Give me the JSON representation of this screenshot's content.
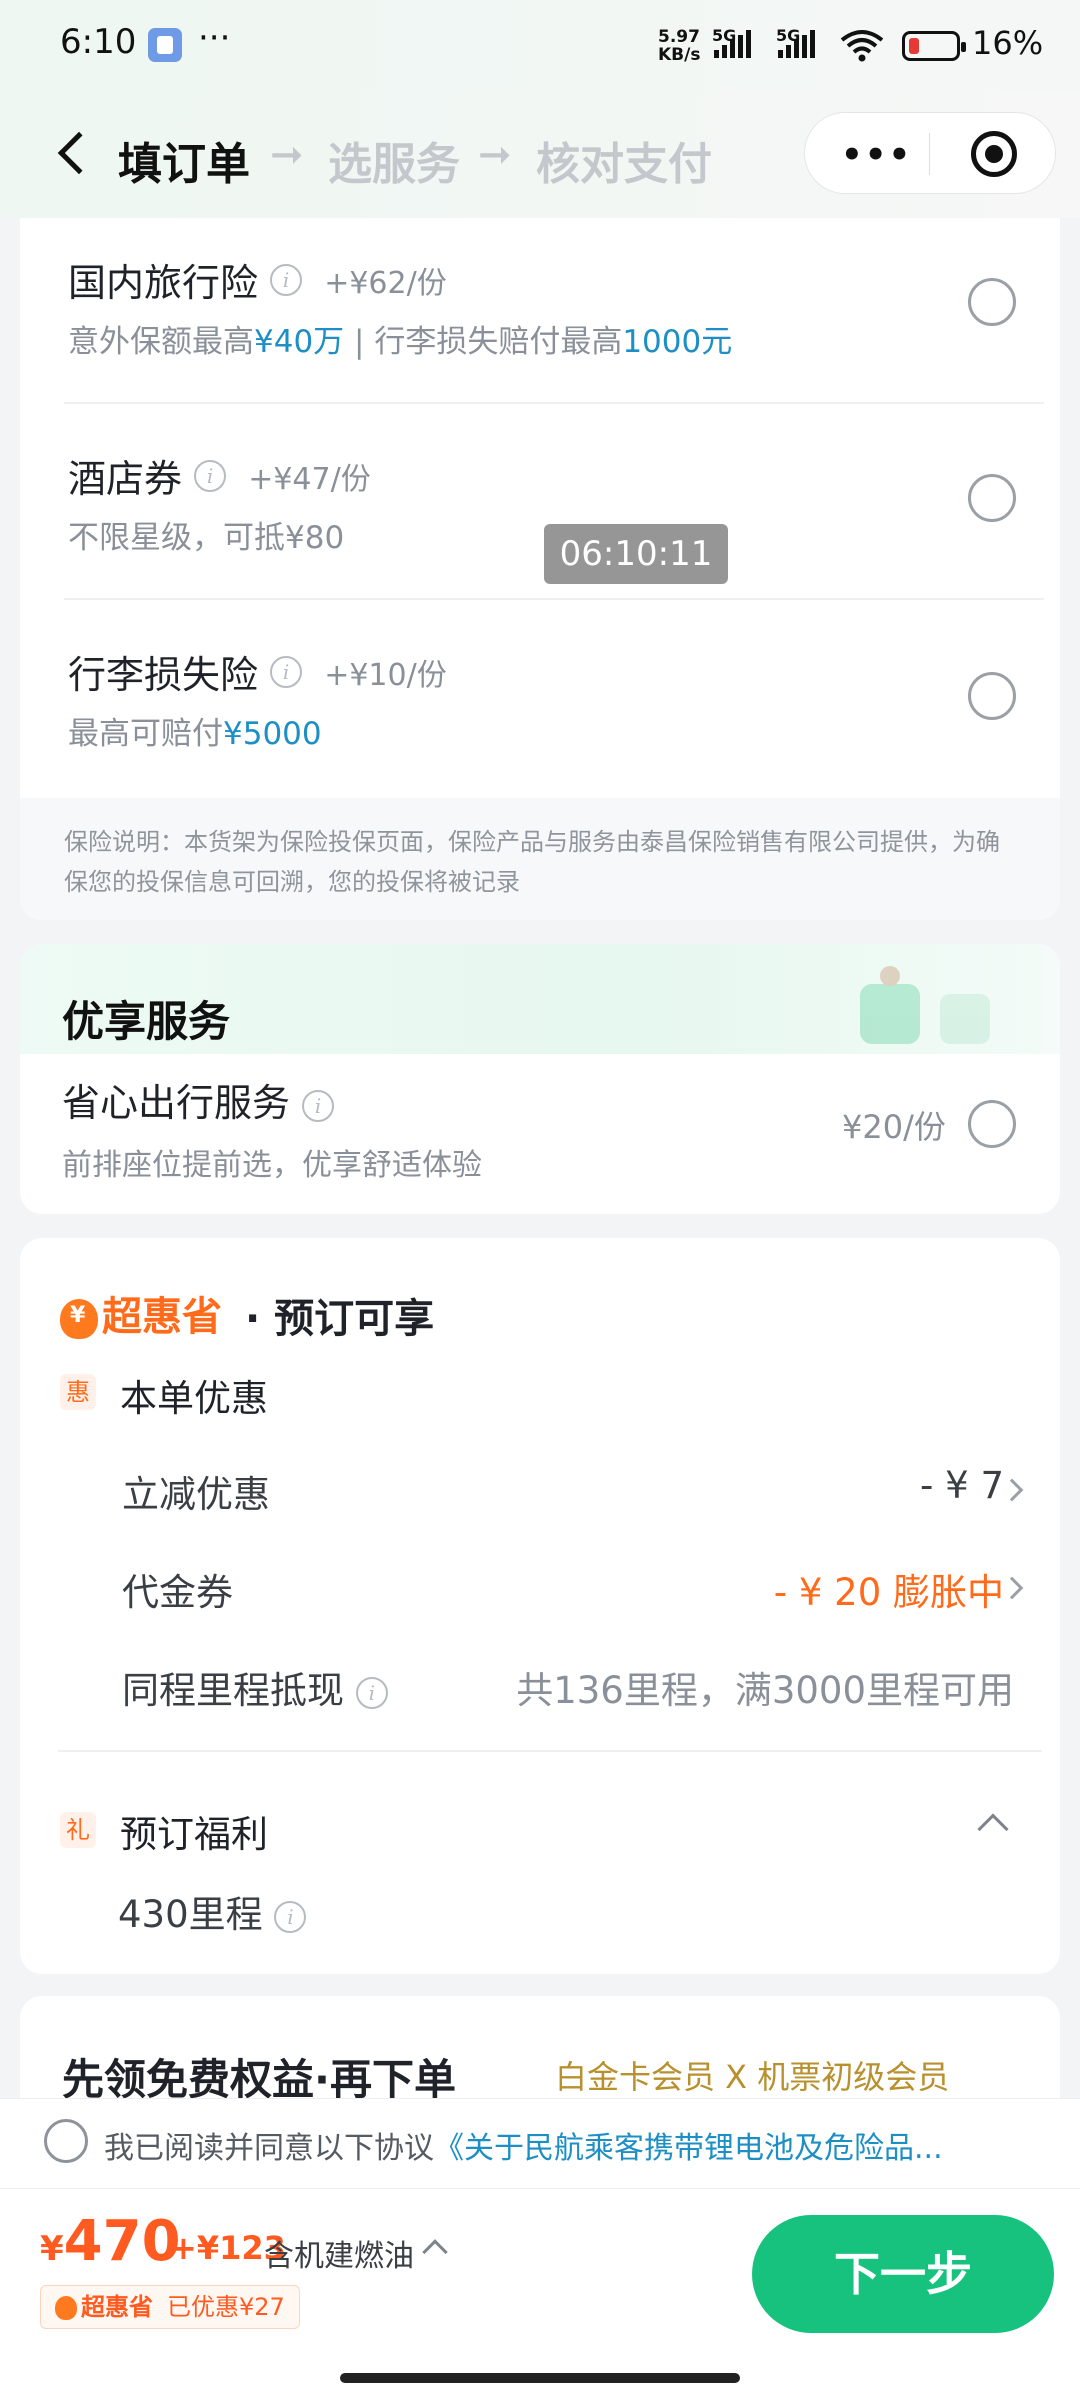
{
  "status_bar": {
    "time": "6:10",
    "more": "···",
    "net_speed_value": "5.97",
    "net_speed_unit": "KB/s",
    "sim1": "5G",
    "sim2": "5G",
    "battery": "16%"
  },
  "nav": {
    "steps": [
      "填订单",
      "选服务",
      "核对支付"
    ],
    "arrow": "➞",
    "capsule_more": "•••"
  },
  "insurance": {
    "items": [
      {
        "title": "国内旅行险",
        "price": "+¥62/份",
        "desc_pre": "意外保额最高",
        "desc_hl": "¥40万",
        "desc_mid": " | 行李损失赔付最高",
        "desc_hl2": "1000元"
      },
      {
        "title": "酒店券",
        "price": "+¥47/份",
        "desc_pre": "不限星级，可抵¥80",
        "desc_hl": "",
        "desc_mid": "",
        "desc_hl2": ""
      },
      {
        "title": "行李损失险",
        "price": "+¥10/份",
        "desc_pre": "最高可赔付",
        "desc_hl": "¥5000",
        "desc_mid": "",
        "desc_hl2": ""
      }
    ],
    "note": "保险说明：本货架为保险投保页面，保险产品与服务由泰昌保险销售有限公司提供，为确保您的投保信息可回溯，您的投保将被记录"
  },
  "service": {
    "heading": "优享服务",
    "name": "省心出行服务",
    "desc": "前排座位提前选，优享舒适体验",
    "price": "¥20/份"
  },
  "discount": {
    "brand": "超惠省",
    "title": "· 预订可享",
    "section1_tag": "惠",
    "section1_label": "本单优惠",
    "rows": [
      {
        "label": "立减优惠",
        "value": "- ¥ 7"
      },
      {
        "label": "代金券",
        "value": "- ¥ 20  膨胀中"
      },
      {
        "label": "同程里程抵现",
        "value": "共136里程，满3000里程可用"
      }
    ],
    "section2_tag": "礼",
    "section2_label": "预订福利",
    "benefit": "430里程"
  },
  "free_benefits": {
    "title": "先领免费权益·再下单",
    "member": "白金卡会员 X 机票初级会员"
  },
  "agreement": {
    "text": "我已阅读并同意以下协议",
    "link": "《关于民航乘客携带锂电池及危险品..."
  },
  "bottom": {
    "currency": "¥",
    "price": "470",
    "tax": "+¥123",
    "tax_note": "含机建燃油",
    "brand": "超惠省",
    "saved": "已优惠¥27",
    "next": "下一步"
  },
  "overlay": {
    "timestamp": "06:10:11"
  },
  "colors": {
    "accent_green": "#17c27f",
    "price_orange": "#ff5a1f",
    "highlight_blue": "#1d8fc5"
  }
}
